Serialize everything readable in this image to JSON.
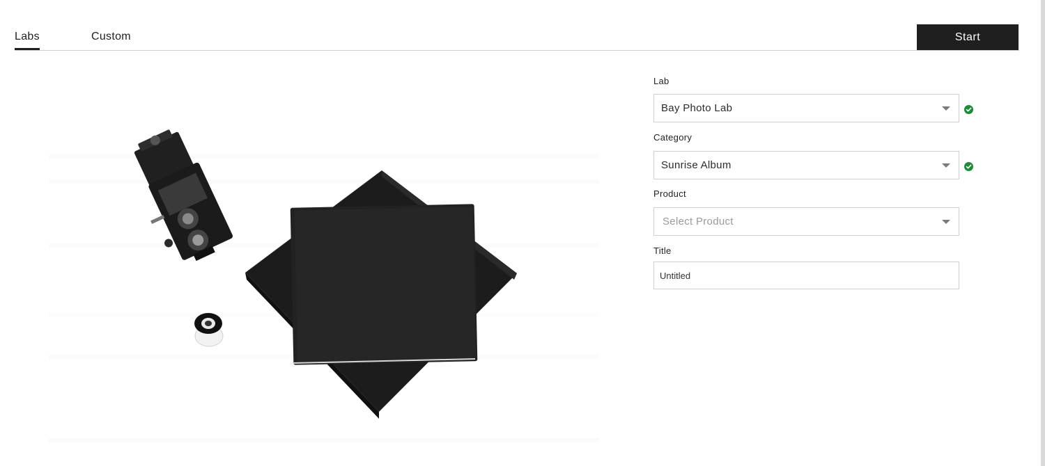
{
  "tabs": {
    "labs": "Labs",
    "custom": "Custom"
  },
  "start_label": "Start",
  "form": {
    "lab": {
      "label": "Lab",
      "value": "Bay Photo Lab",
      "valid": true
    },
    "category": {
      "label": "Category",
      "value": "Sunrise Album",
      "valid": true
    },
    "product": {
      "label": "Product",
      "placeholder": "Select Product"
    },
    "title": {
      "label": "Title",
      "value": "Untitled"
    }
  },
  "colors": {
    "accent": "#1f1f1f",
    "valid_check": "#1e8a3a",
    "border": "#cfcfcf"
  },
  "icons": {
    "caret": "chevron-down-icon",
    "valid": "check-circle-icon"
  }
}
